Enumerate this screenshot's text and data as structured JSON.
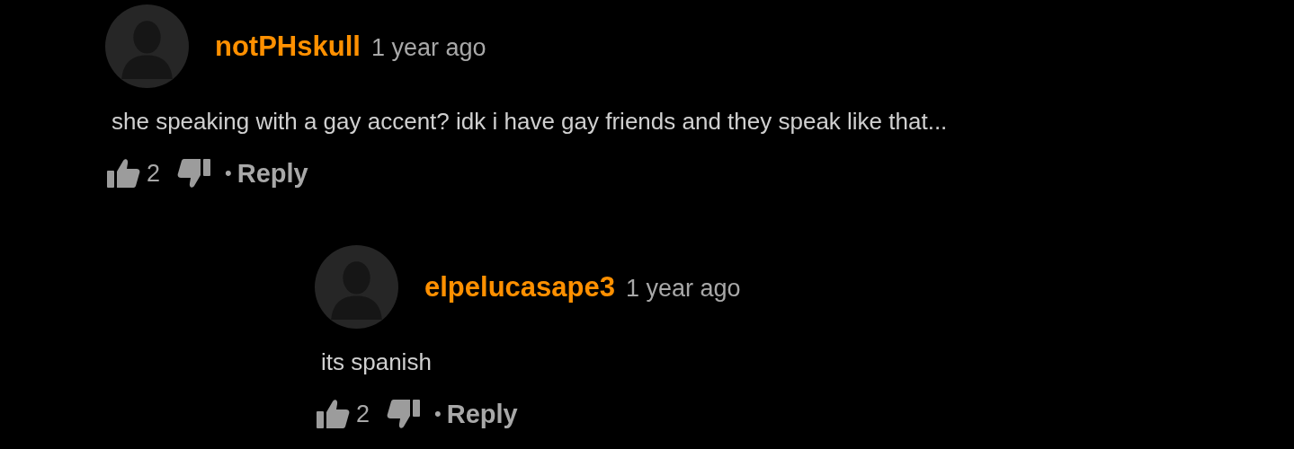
{
  "comments": [
    {
      "username": "notPHskull",
      "time": "1 year ago",
      "text": "she speaking with a gay accent? idk i have gay friends and they speak like that...",
      "likes": "2",
      "separator": "•",
      "reply": "Reply",
      "children": [
        {
          "username": "elpelucasape3",
          "time": "1 year ago",
          "text": "its spanish",
          "likes": "2",
          "separator": "•",
          "reply": "Reply"
        }
      ]
    }
  ]
}
